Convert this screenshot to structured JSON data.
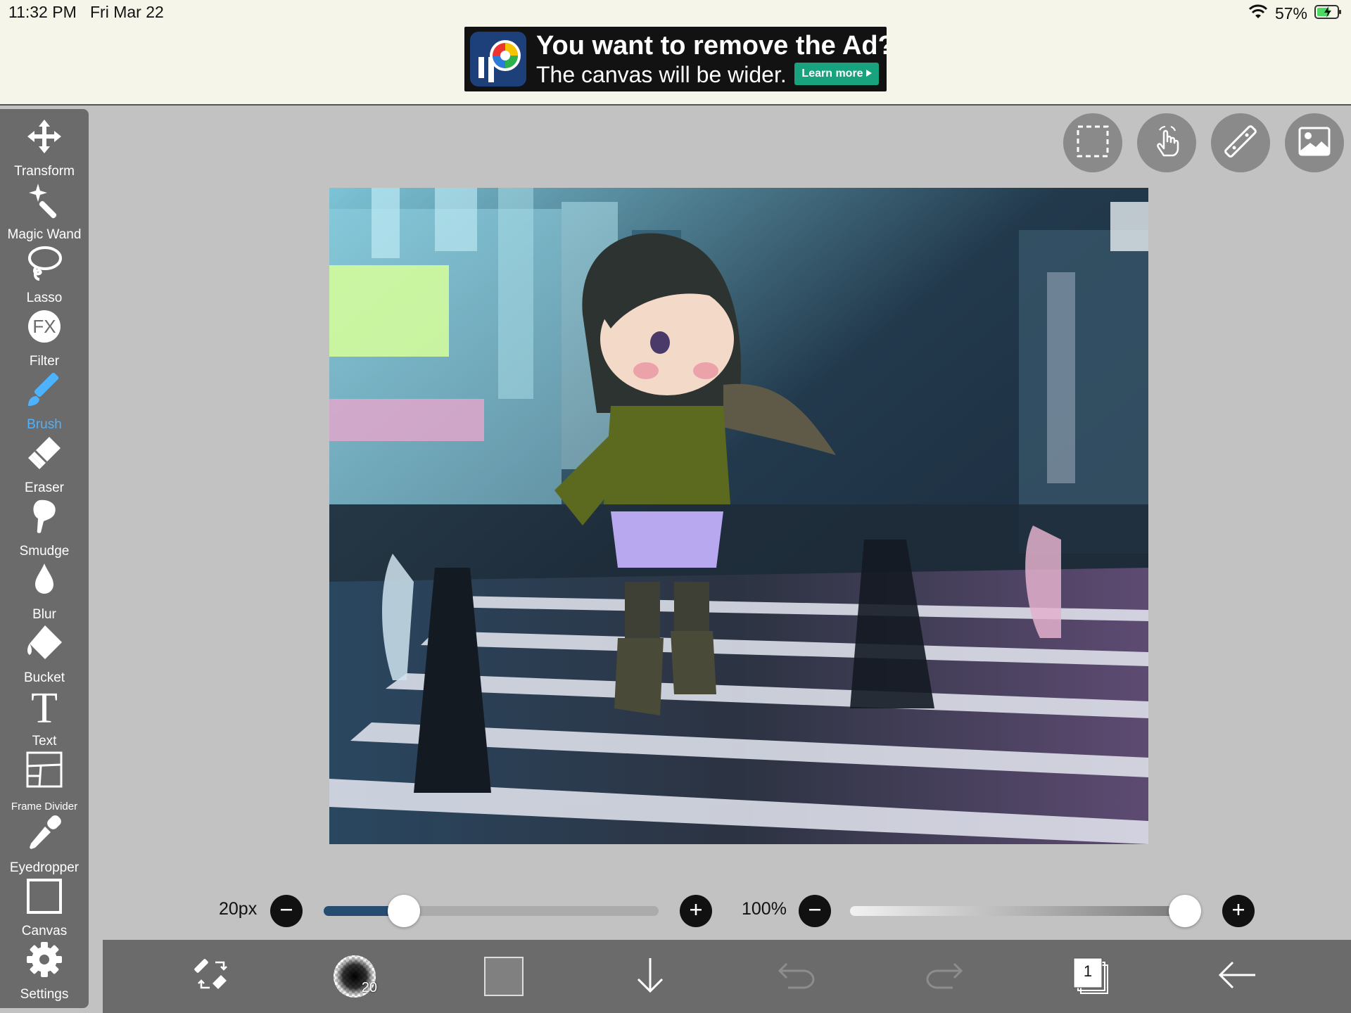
{
  "status_bar": {
    "time": "11:32 PM",
    "date": "Fri Mar 22",
    "battery": "57%"
  },
  "ad": {
    "title": "You want to remove the Ad?",
    "subtitle": "The canvas will be wider.",
    "learn_more": "Learn more"
  },
  "toolbar": {
    "tools": [
      {
        "label": "Transform",
        "icon": "move-arrows-icon"
      },
      {
        "label": "Magic Wand",
        "icon": "magic-wand-icon"
      },
      {
        "label": "Lasso",
        "icon": "lasso-icon"
      },
      {
        "label": "Filter",
        "icon": "fx-icon",
        "glyph": "FX"
      },
      {
        "label": "Brush",
        "icon": "brush-icon",
        "active": true
      },
      {
        "label": "Eraser",
        "icon": "eraser-icon"
      },
      {
        "label": "Smudge",
        "icon": "smudge-icon"
      },
      {
        "label": "Blur",
        "icon": "droplet-icon"
      },
      {
        "label": "Bucket",
        "icon": "bucket-icon"
      },
      {
        "label": "Text",
        "icon": "text-icon",
        "glyph": "T"
      },
      {
        "label": "Frame Divider",
        "icon": "frame-divider-icon"
      },
      {
        "label": "Eyedropper",
        "icon": "eyedropper-icon"
      },
      {
        "label": "Canvas",
        "icon": "canvas-icon"
      },
      {
        "label": "Settings",
        "icon": "gear-icon"
      }
    ],
    "active_color": "#4db3ff"
  },
  "top_buttons": [
    "selection-icon",
    "hand-gesture-icon",
    "ruler-icon",
    "image-icon"
  ],
  "sliders": {
    "brush_size": {
      "label": "20px",
      "value_fraction": 0.24
    },
    "opacity": {
      "label": "100%",
      "value_fraction": 1.0
    }
  },
  "bottom_bar": {
    "brush_size_badge": "20",
    "layer_count": "1",
    "items": [
      "swap-tool-icon",
      "brush-preview",
      "color-swatch",
      "download-arrow-icon",
      "undo-icon",
      "redo-icon",
      "layers-icon",
      "back-arrow-icon"
    ],
    "color_swatch": "#808080"
  }
}
